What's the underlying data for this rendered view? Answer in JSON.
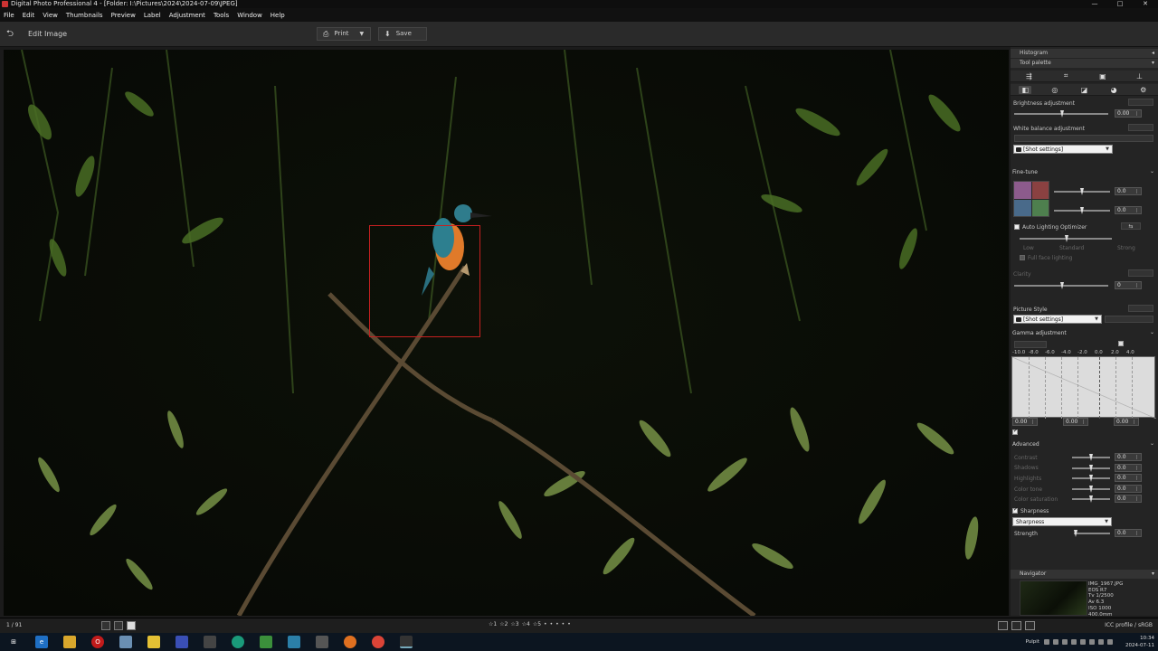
{
  "window": {
    "title": "Digital Photo Professional 4 - [Folder: I:\\Pictures\\2024\\2024-07-09\\JPEG]",
    "controls": [
      "—",
      "□",
      "✕"
    ]
  },
  "menu": [
    "File",
    "Edit",
    "View",
    "Thumbnails",
    "Preview",
    "Label",
    "Adjustment",
    "Tools",
    "Window",
    "Help"
  ],
  "toolbar": {
    "back_icon": "back-arrow-icon",
    "title": "Edit Image",
    "print_label": "Print",
    "save_label": "Save"
  },
  "panel": {
    "histogram_label": "Histogram",
    "tool_palette_label": "Tool palette",
    "brightness": {
      "label": "Brightness adjustment",
      "value": "0.00"
    },
    "white_balance": {
      "label": "White balance adjustment",
      "preset": "[Shot settings]"
    },
    "fine_tune": {
      "label": "Fine-tune",
      "value1": "0.0",
      "value2": "0.0"
    },
    "alo": {
      "label": "Auto Lighting Optimizer",
      "low": "Low",
      "standard": "Standard",
      "strong": "Strong",
      "face": "Full face lighting"
    },
    "clarity": {
      "label": "Clarity",
      "value": "0"
    },
    "picture_style": {
      "label": "Picture Style",
      "preset": "[Shot settings]"
    },
    "gamma": {
      "label": "Gamma adjustment",
      "ticks": [
        "-10.0",
        "-8.0",
        "-6.0",
        "-4.0",
        "-2.0",
        "0.0",
        "2.0",
        "4.0"
      ],
      "left": "0.00",
      "mid": "0.00",
      "right": "0.00"
    },
    "advanced": {
      "label": "Advanced",
      "rows": [
        "Contrast",
        "Shadows",
        "Highlights",
        "Color tone",
        "Color saturation"
      ],
      "value": "0.0"
    },
    "sharpness": {
      "label": "Sharpness",
      "mode": "Sharpness",
      "strength_label": "Strength",
      "strength_value": "0.0"
    },
    "navigator": {
      "label": "Navigator",
      "file": "IMG_1967.JPG",
      "camera": "EOS R7",
      "tv": "Tv 1/2500",
      "av": "Av 6.3",
      "iso": "ISO 1000",
      "focal": "400.0mm"
    }
  },
  "status": {
    "count": "1 / 91",
    "icc": "ICC profile / sRGB",
    "rating": [
      "☆1",
      "☆2",
      "☆3",
      "☆4",
      "☆5",
      "•",
      "•",
      "•",
      "•",
      "•"
    ]
  },
  "tray": {
    "pulpit": "Pulpit",
    "time": "10:34",
    "date": "2024-07-11"
  },
  "colors": {
    "focus_box": "#c62020",
    "accent": "#f0f0f0"
  }
}
